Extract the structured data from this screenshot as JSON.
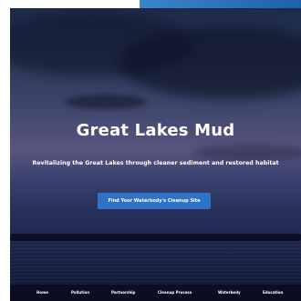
{
  "hero": {
    "title": "Great Lakes Mud",
    "subtitle": "Revitalizing the Great Lakes through cleaner sediment and restored habitat",
    "cta_label": "Find Your Waterbody's Cleanup Site"
  },
  "nav": {
    "items": [
      {
        "label": "Home"
      },
      {
        "label": "Pollution"
      },
      {
        "label": "Partnership"
      },
      {
        "label": "Cleanup Process"
      },
      {
        "label": "Waterbody"
      },
      {
        "label": "Education"
      }
    ]
  },
  "colors": {
    "accent_blue": "#2f73c9",
    "nav_background": "#0a0e20",
    "top_bar": "#2a72b8"
  }
}
